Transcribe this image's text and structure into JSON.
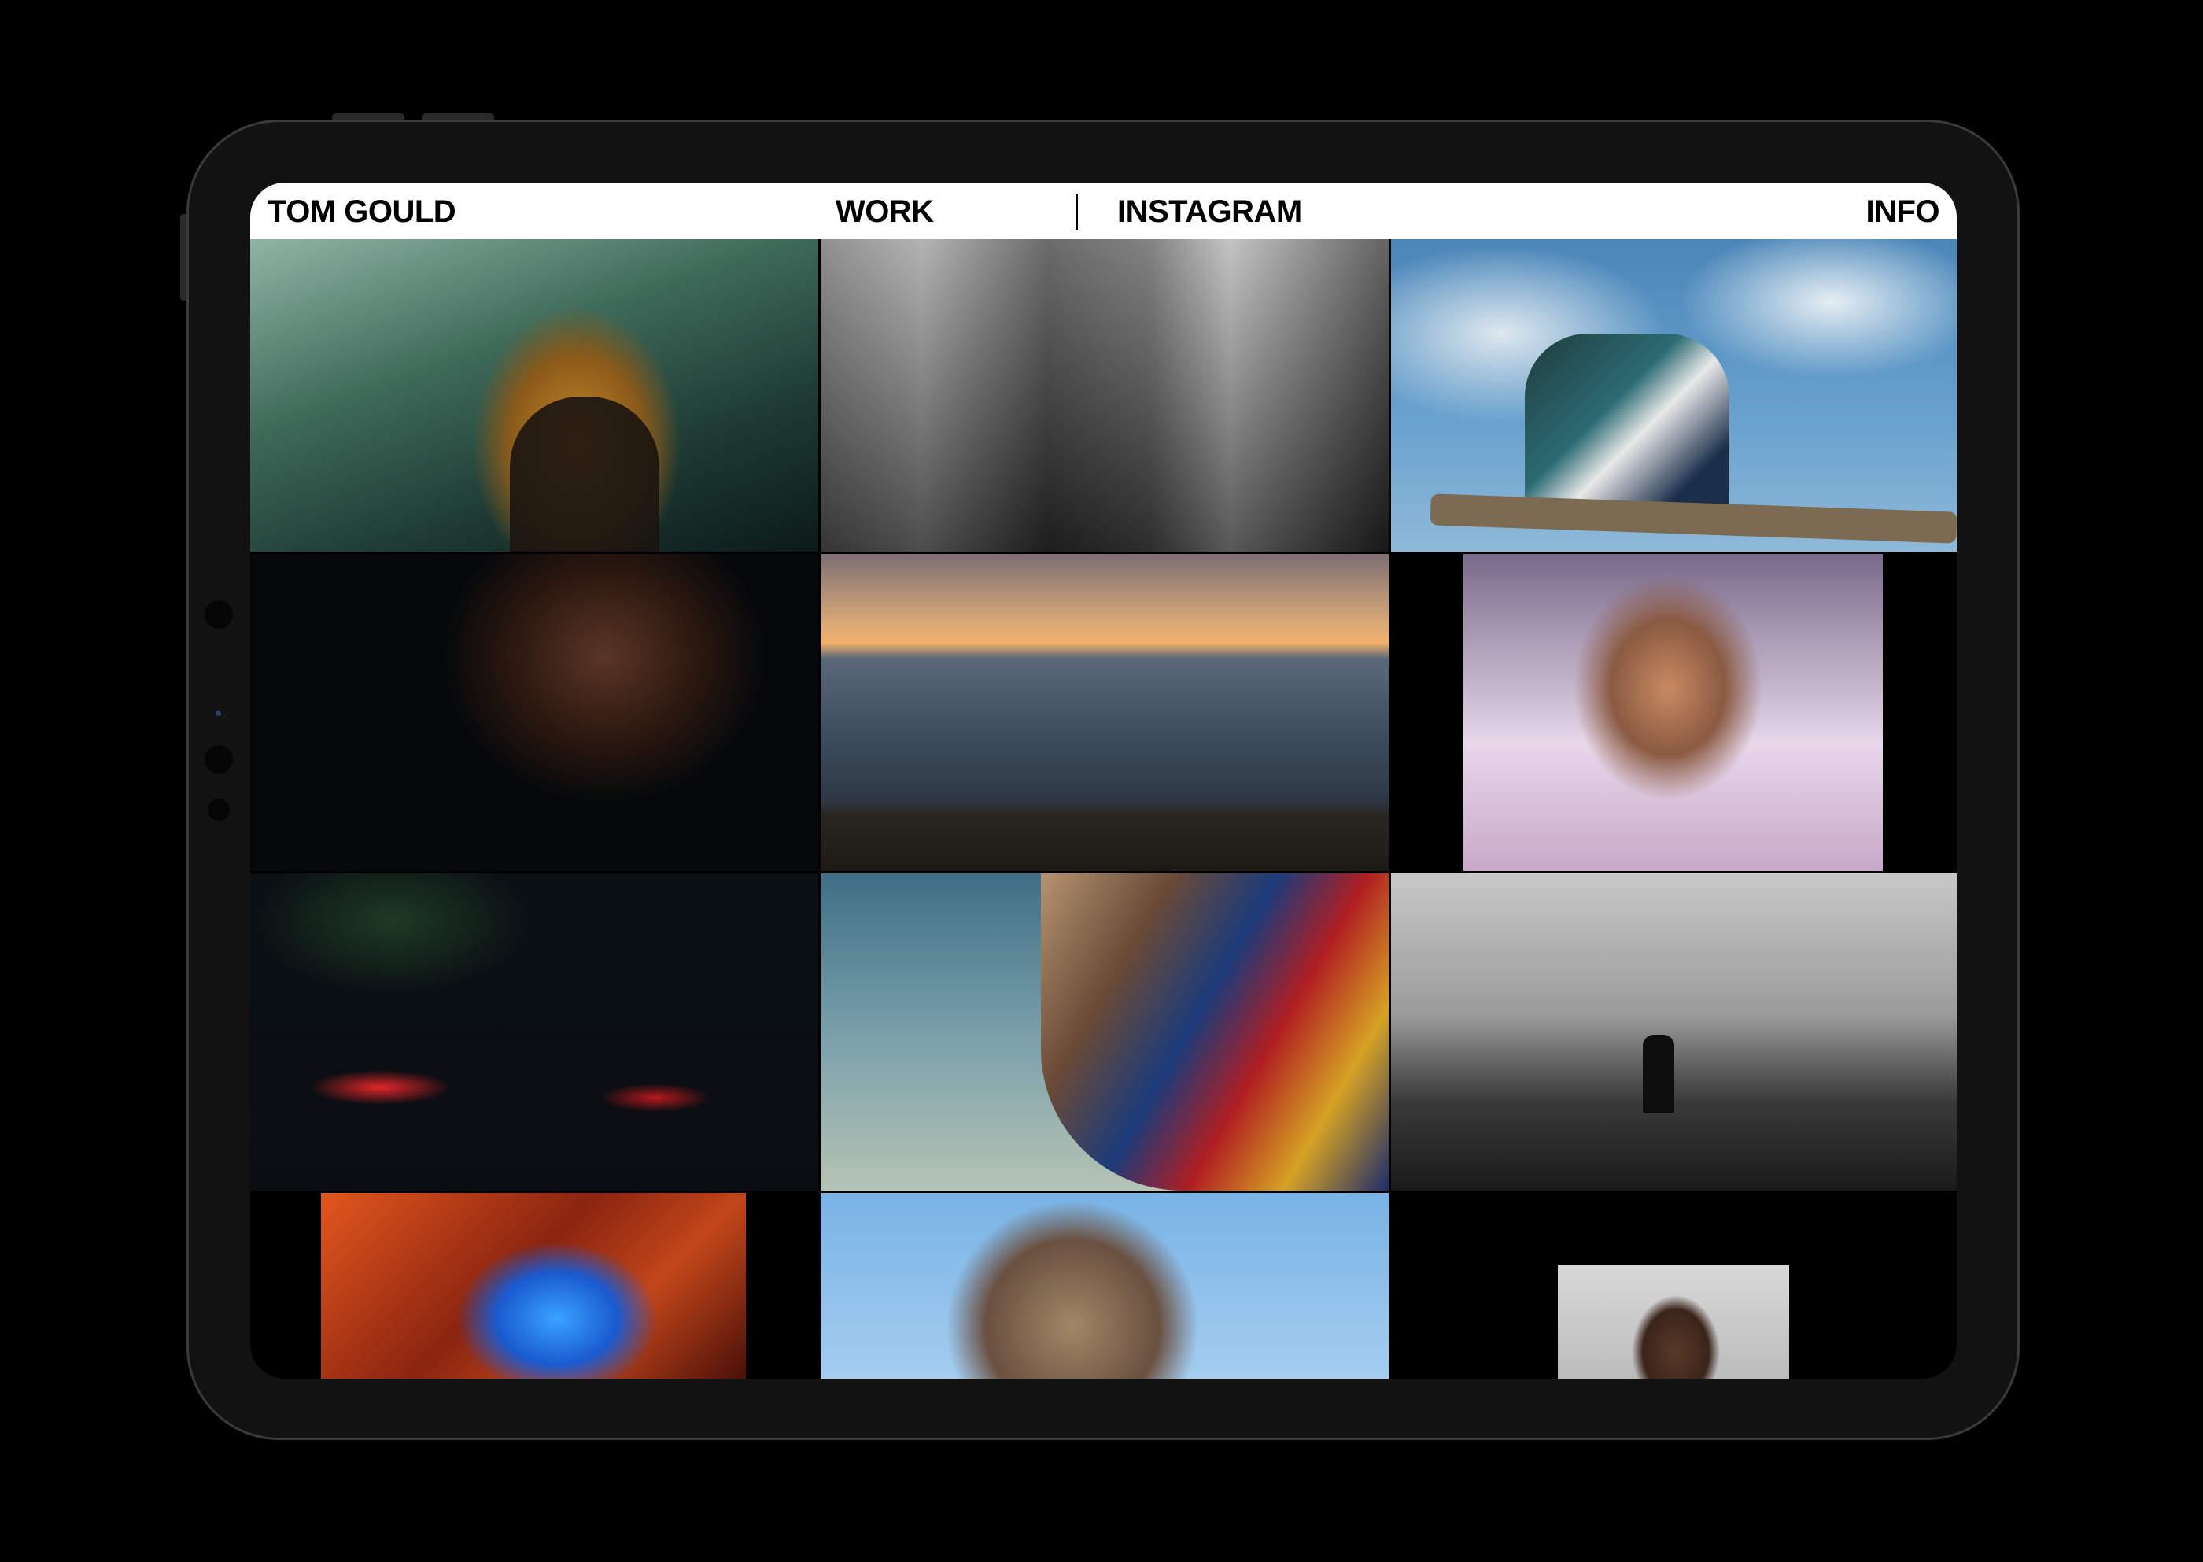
{
  "site": {
    "title": "TOM GOULD"
  },
  "nav": {
    "work": "WORK",
    "instagram": "INSTAGRAM",
    "info": "INFO"
  },
  "colors": {
    "background": "#000000",
    "nav_background": "#ffffff",
    "nav_text": "#000000",
    "device_frame": "#121212"
  },
  "grid": {
    "columns": 3,
    "tiles": 12
  }
}
